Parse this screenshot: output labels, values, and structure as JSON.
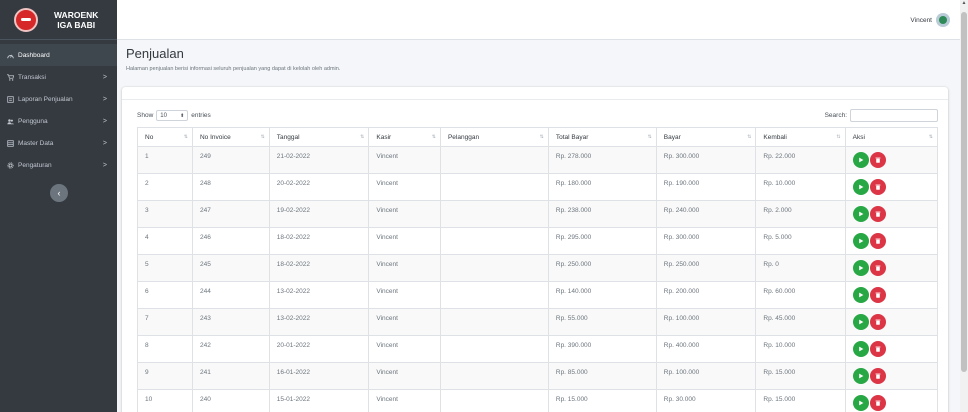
{
  "brand": {
    "line1": "WAROENK",
    "line2": "IGA BABI"
  },
  "sidebar": {
    "items": [
      {
        "label": "Dashboard",
        "icon": "dashboard-icon",
        "chevron": ""
      },
      {
        "label": "Transaksi",
        "icon": "cart-icon",
        "chevron": ">"
      },
      {
        "label": "Laporan Penjualan",
        "icon": "report-icon",
        "chevron": ">"
      },
      {
        "label": "Pengguna",
        "icon": "users-icon",
        "chevron": ">"
      },
      {
        "label": "Master Data",
        "icon": "database-icon",
        "chevron": ">"
      },
      {
        "label": "Pengaturan",
        "icon": "gear-icon",
        "chevron": ">"
      }
    ],
    "collapse_label": "‹"
  },
  "topbar": {
    "user_name": "Vincent"
  },
  "page": {
    "title": "Penjualan",
    "subtitle": "Halaman penjualan berisi informasi seluruh penjualan yang dapat di kelolah oleh admin."
  },
  "table_controls": {
    "show_label": "Show",
    "show_value": "10",
    "entries_label": "entries",
    "search_label": "Search:"
  },
  "table": {
    "headers": [
      "No",
      "No Invoice",
      "Tanggal",
      "Kasir",
      "Pelanggan",
      "Total Bayar",
      "Bayar",
      "Kembali",
      "Aksi"
    ],
    "rows": [
      [
        "1",
        "249",
        "21-02-2022",
        "Vincent",
        "",
        "Rp. 278.000",
        "Rp. 300.000",
        "Rp. 22.000"
      ],
      [
        "2",
        "248",
        "20-02-2022",
        "Vincent",
        "",
        "Rp. 180.000",
        "Rp. 190.000",
        "Rp. 10.000"
      ],
      [
        "3",
        "247",
        "19-02-2022",
        "Vincent",
        "",
        "Rp. 238.000",
        "Rp. 240.000",
        "Rp. 2.000"
      ],
      [
        "4",
        "246",
        "18-02-2022",
        "Vincent",
        "",
        "Rp. 295.000",
        "Rp. 300.000",
        "Rp. 5.000"
      ],
      [
        "5",
        "245",
        "18-02-2022",
        "Vincent",
        "",
        "Rp. 250.000",
        "Rp. 250.000",
        "Rp. 0"
      ],
      [
        "6",
        "244",
        "13-02-2022",
        "Vincent",
        "",
        "Rp. 140.000",
        "Rp. 200.000",
        "Rp. 60.000"
      ],
      [
        "7",
        "243",
        "13-02-2022",
        "Vincent",
        "",
        "Rp. 55.000",
        "Rp. 100.000",
        "Rp. 45.000"
      ],
      [
        "8",
        "242",
        "20-01-2022",
        "Vincent",
        "",
        "Rp. 390.000",
        "Rp. 400.000",
        "Rp. 10.000"
      ],
      [
        "9",
        "241",
        "16-01-2022",
        "Vincent",
        "",
        "Rp. 85.000",
        "Rp. 100.000",
        "Rp. 15.000"
      ],
      [
        "10",
        "240",
        "15-01-2022",
        "Vincent",
        "",
        "Rp. 15.000",
        "Rp. 30.000",
        "Rp. 15.000"
      ]
    ]
  },
  "colors": {
    "sidebar": "#343a40",
    "detail_button": "#28a745",
    "delete_button": "#dc3545"
  }
}
